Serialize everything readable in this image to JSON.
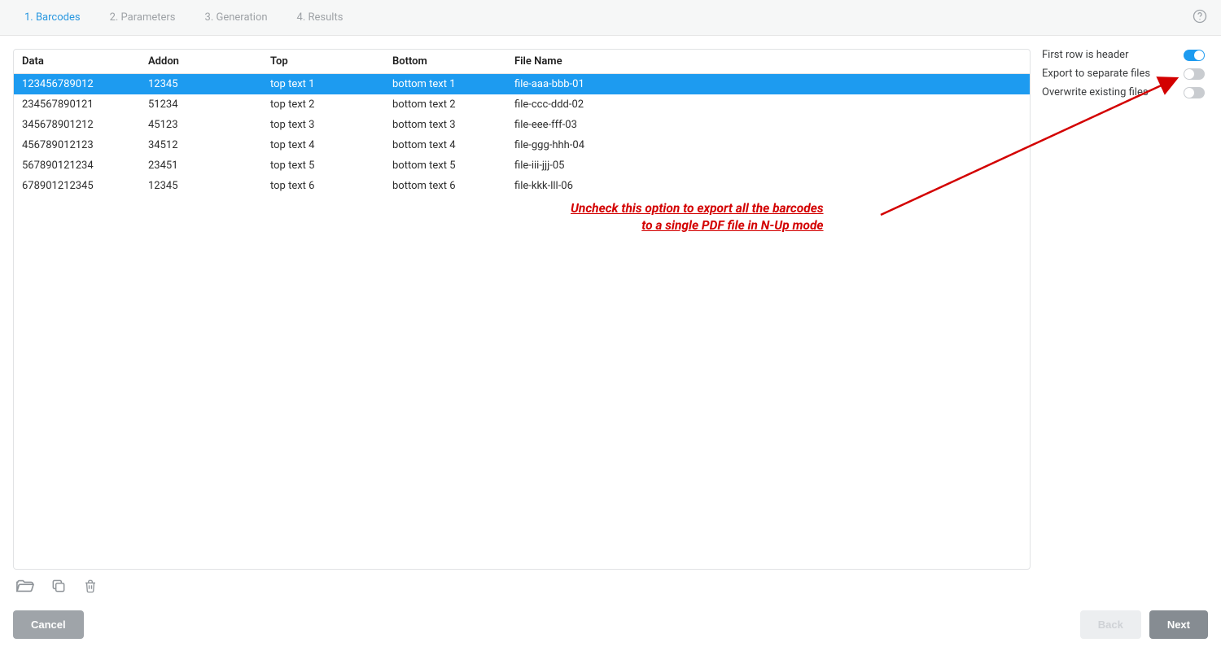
{
  "tabs": [
    {
      "label": "1. Barcodes",
      "active": true
    },
    {
      "label": "2. Parameters",
      "active": false
    },
    {
      "label": "3. Generation",
      "active": false
    },
    {
      "label": "4. Results",
      "active": false
    }
  ],
  "table": {
    "headers": [
      "Data",
      "Addon",
      "Top",
      "Bottom",
      "File Name"
    ],
    "rows": [
      {
        "cells": [
          "123456789012",
          "12345",
          "top text 1",
          "bottom text 1",
          "file-aaa-bbb-01"
        ],
        "selected": true
      },
      {
        "cells": [
          "234567890121",
          "51234",
          "top text 2",
          "bottom text 2",
          "file-ccc-ddd-02"
        ],
        "selected": false
      },
      {
        "cells": [
          "345678901212",
          "45123",
          "top text 3",
          "bottom text 3",
          "file-eee-fff-03"
        ],
        "selected": false
      },
      {
        "cells": [
          "456789012123",
          "34512",
          "top text 4",
          "bottom text 4",
          "file-ggg-hhh-04"
        ],
        "selected": false
      },
      {
        "cells": [
          "567890121234",
          "23451",
          "top text 5",
          "bottom text 5",
          "file-iii-jjj-05"
        ],
        "selected": false
      },
      {
        "cells": [
          "678901212345",
          "12345",
          "top text 6",
          "bottom text 6",
          "file-kkk-lll-06"
        ],
        "selected": false
      }
    ]
  },
  "options": [
    {
      "label": "First row is header",
      "on": true,
      "name": "toggle-first-row-header"
    },
    {
      "label": "Export to separate files",
      "on": false,
      "name": "toggle-export-separate-files"
    },
    {
      "label": "Overwrite existing files",
      "on": false,
      "name": "toggle-overwrite-existing"
    }
  ],
  "annotation": {
    "line1": "Uncheck this option to export all the barcodes",
    "line2": "to a single PDF file in N-Up mode"
  },
  "buttons": {
    "cancel": "Cancel",
    "back": "Back",
    "next": "Next"
  },
  "toolbar_icons": [
    "open-folder-icon",
    "copy-icon",
    "trash-icon"
  ]
}
